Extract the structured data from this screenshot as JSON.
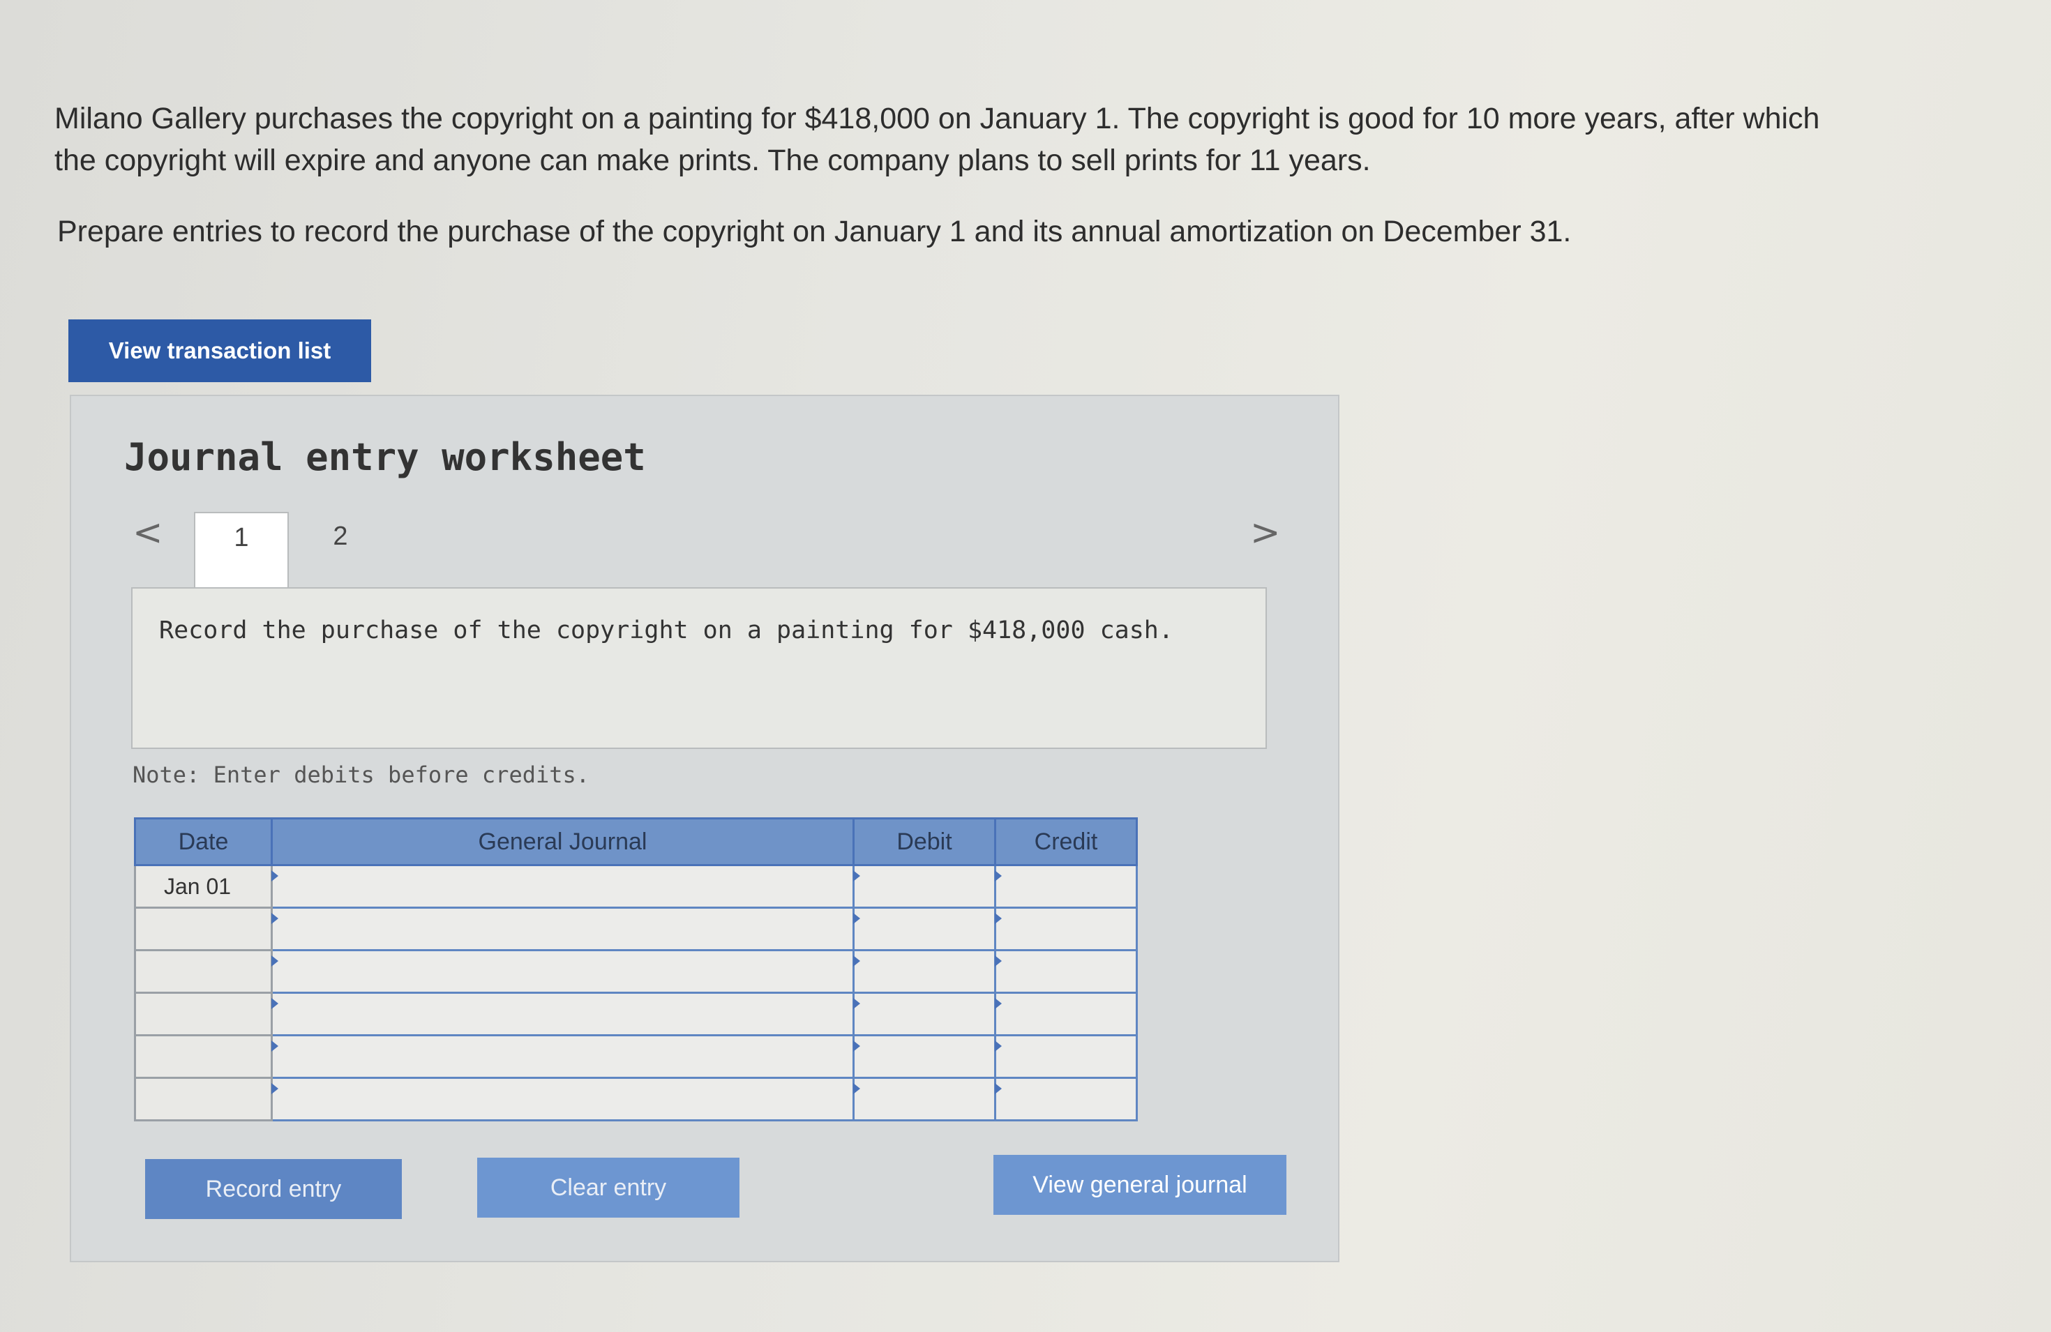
{
  "problem": {
    "text": "Milano Gallery purchases the copyright on a painting for $418,000 on January 1. The copyright is good for 10 more years, after which the copyright will expire and anyone can make prints. The company plans to sell prints for 11 years.",
    "prompt": "Prepare entries to record the purchase of the copyright on January 1 and its annual amortization on December 31."
  },
  "buttons": {
    "view_transaction_list": "View transaction list",
    "record_entry": "Record entry",
    "clear_entry": "Clear entry",
    "view_general_journal": "View general journal"
  },
  "worksheet": {
    "title": "Journal entry worksheet",
    "prev_arrow": "<",
    "next_arrow": ">",
    "pages": [
      "1",
      "2"
    ],
    "active_page": "1",
    "instruction": "Record the purchase of the copyright on a painting for $418,000 cash.",
    "note": "Note: Enter debits before credits."
  },
  "journal_table": {
    "headers": {
      "date": "Date",
      "general_journal": "General Journal",
      "debit": "Debit",
      "credit": "Credit"
    },
    "rows": [
      {
        "date": "Jan 01",
        "account": "",
        "debit": "",
        "credit": ""
      },
      {
        "date": "",
        "account": "",
        "debit": "",
        "credit": ""
      },
      {
        "date": "",
        "account": "",
        "debit": "",
        "credit": ""
      },
      {
        "date": "",
        "account": "",
        "debit": "",
        "credit": ""
      },
      {
        "date": "",
        "account": "",
        "debit": "",
        "credit": ""
      },
      {
        "date": "",
        "account": "",
        "debit": "",
        "credit": ""
      }
    ]
  }
}
